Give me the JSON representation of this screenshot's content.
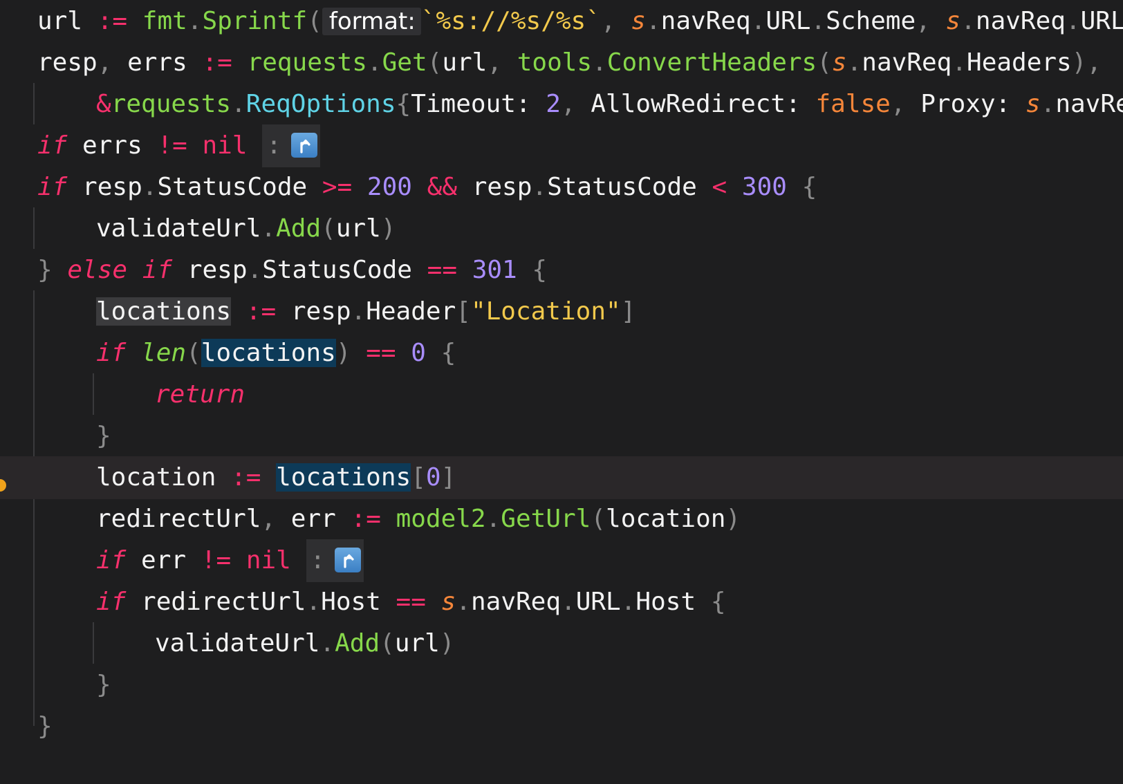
{
  "editor": {
    "language": "go",
    "current_line": 12,
    "colors": {
      "background": "#1e1e1f",
      "current_line": "#2a2729",
      "keyword": "#f6306c",
      "function": "#87d84b",
      "type": "#5fd3e6",
      "number": "#a98dfc",
      "string": "#f2c94c",
      "bool": "#f5863a",
      "identifier": "#f3f3f3",
      "punctuation": "#8b8b8b",
      "breakpoint": "#f0a21b"
    },
    "icons": {
      "fold_collapsed": "return-arrow-icon",
      "breakpoint": "breakpoint-dot-icon"
    }
  },
  "code": {
    "l1": {
      "url": "url",
      "assign": ":=",
      "fmt": "fmt",
      "dot1": ".",
      "sprintf": "Sprintf",
      "lp": "(",
      "hint": "format:",
      "fmtstr": "`%s://%s/%s`",
      "c1": ",",
      "s1": "s",
      "d2": ".",
      "navreq1": "navReq",
      "d3": ".",
      "url1": "URL",
      "d4": ".",
      "scheme": "Scheme",
      "c2": ",",
      "s2": "s",
      "d5": ".",
      "navreq2": "navReq",
      "d6": ".",
      "tail": "URL"
    },
    "l2": {
      "resp": "resp",
      "c1": ",",
      "errs": "errs",
      "assign": ":=",
      "requests": "requests",
      "d1": ".",
      "get": "Get",
      "lp": "(",
      "url": "url",
      "c2": ",",
      "tools": "tools",
      "d2": ".",
      "convert": "ConvertHeaders",
      "lp2": "(",
      "s": "s",
      "d3": ".",
      "navreq": "navReq",
      "d4": ".",
      "headers": "Headers",
      "rp": ")",
      "c3": ","
    },
    "l3": {
      "amp": "&",
      "requests": "requests",
      "d1": ".",
      "reqopts": "ReqOptions",
      "lb": "{",
      "timeout": "Timeout:",
      "two": "2",
      "c1": ",",
      "allow": "AllowRedirect:",
      "false": "false",
      "c2": ",",
      "proxy": "Proxy:",
      "s": "s",
      "d2": ".",
      "tail": "navReq"
    },
    "l4": {
      "if": "if",
      "errs": "errs",
      "ne": "!=",
      "nil": "nil",
      "colon": ":"
    },
    "l5": {
      "if": "if",
      "resp1": "resp",
      "d1": ".",
      "sc1": "StatusCode",
      "ge": ">=",
      "n200": "200",
      "and": "&&",
      "resp2": "resp",
      "d2": ".",
      "sc2": "StatusCode",
      "lt": "<",
      "n300": "300",
      "lb": "{"
    },
    "l6": {
      "validate": "validateUrl",
      "d1": ".",
      "add": "Add",
      "lp": "(",
      "url": "url",
      "rp": ")"
    },
    "l7": {
      "rb": "}",
      "else": "else",
      "if": "if",
      "resp": "resp",
      "d1": ".",
      "sc": "StatusCode",
      "eq": "==",
      "n301": "301",
      "lb": "{"
    },
    "l8": {
      "locations": "locations",
      "assign": ":=",
      "resp": "resp",
      "d1": ".",
      "header": "Header",
      "lb": "[",
      "str": "\"Location\"",
      "rb": "]"
    },
    "l9": {
      "if": "if",
      "len": "len",
      "lp": "(",
      "locations": "locations",
      "rp": ")",
      "eq": "==",
      "zero": "0",
      "lb": "{"
    },
    "l10": {
      "return": "return"
    },
    "l11": {
      "rb": "}"
    },
    "l12": {
      "location": "location",
      "assign": ":=",
      "locations": "locations",
      "lb": "[",
      "zero": "0",
      "rb": "]"
    },
    "l13": {
      "redirect": "redirectUrl",
      "c1": ",",
      "err": "err",
      "assign": ":=",
      "model2": "model2",
      "d1": ".",
      "geturl": "GetUrl",
      "lp": "(",
      "location": "location",
      "rp": ")"
    },
    "l14": {
      "if": "if",
      "err": "err",
      "ne": "!=",
      "nil": "nil",
      "colon": ":"
    },
    "l15": {
      "if": "if",
      "redirect": "redirectUrl",
      "d1": ".",
      "host1": "Host",
      "eq": "==",
      "s": "s",
      "d2": ".",
      "navreq": "navReq",
      "d3": ".",
      "url": "URL",
      "d4": ".",
      "host2": "Host",
      "lb": "{"
    },
    "l16": {
      "validate": "validateUrl",
      "d1": ".",
      "add": "Add",
      "lp": "(",
      "url": "url",
      "rp": ")"
    },
    "l17": {
      "rb": "}"
    },
    "l18": {
      "rb": "}"
    }
  }
}
